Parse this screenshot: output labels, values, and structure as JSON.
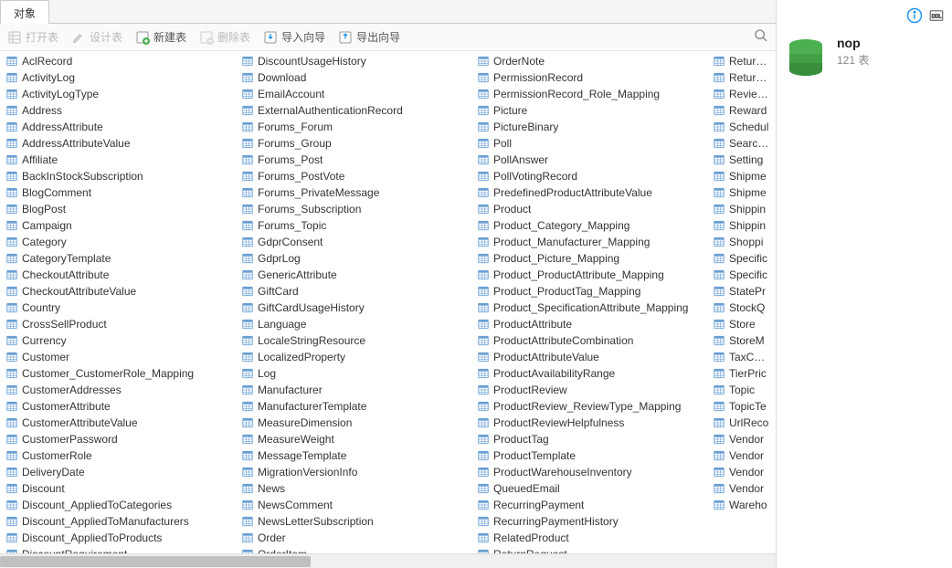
{
  "tab": {
    "label": "对象"
  },
  "toolbar": {
    "open": "打开表",
    "design": "设计表",
    "new": "新建表",
    "delete": "删除表",
    "import": "导入向导",
    "export": "导出向导"
  },
  "side": {
    "db_name": "nop",
    "table_count": "121 表"
  },
  "columns": [
    [
      "AclRecord",
      "ActivityLog",
      "ActivityLogType",
      "Address",
      "AddressAttribute",
      "AddressAttributeValue",
      "Affiliate",
      "BackInStockSubscription",
      "BlogComment",
      "BlogPost",
      "Campaign",
      "Category",
      "CategoryTemplate",
      "CheckoutAttribute",
      "CheckoutAttributeValue",
      "Country",
      "CrossSellProduct",
      "Currency",
      "Customer",
      "Customer_CustomerRole_Mapping",
      "CustomerAddresses",
      "CustomerAttribute",
      "CustomerAttributeValue",
      "CustomerPassword",
      "CustomerRole",
      "DeliveryDate",
      "Discount",
      "Discount_AppliedToCategories",
      "Discount_AppliedToManufacturers",
      "Discount_AppliedToProducts",
      "DiscountRequirement"
    ],
    [
      "DiscountUsageHistory",
      "Download",
      "EmailAccount",
      "ExternalAuthenticationRecord",
      "Forums_Forum",
      "Forums_Group",
      "Forums_Post",
      "Forums_PostVote",
      "Forums_PrivateMessage",
      "Forums_Subscription",
      "Forums_Topic",
      "GdprConsent",
      "GdprLog",
      "GenericAttribute",
      "GiftCard",
      "GiftCardUsageHistory",
      "Language",
      "LocaleStringResource",
      "LocalizedProperty",
      "Log",
      "Manufacturer",
      "ManufacturerTemplate",
      "MeasureDimension",
      "MeasureWeight",
      "MessageTemplate",
      "MigrationVersionInfo",
      "News",
      "NewsComment",
      "NewsLetterSubscription",
      "Order",
      "OrderItem"
    ],
    [
      "OrderNote",
      "PermissionRecord",
      "PermissionRecord_Role_Mapping",
      "Picture",
      "PictureBinary",
      "Poll",
      "PollAnswer",
      "PollVotingRecord",
      "PredefinedProductAttributeValue",
      "Product",
      "Product_Category_Mapping",
      "Product_Manufacturer_Mapping",
      "Product_Picture_Mapping",
      "Product_ProductAttribute_Mapping",
      "Product_ProductTag_Mapping",
      "Product_SpecificationAttribute_Mapping",
      "ProductAttribute",
      "ProductAttributeCombination",
      "ProductAttributeValue",
      "ProductAvailabilityRange",
      "ProductReview",
      "ProductReview_ReviewType_Mapping",
      "ProductReviewHelpfulness",
      "ProductTag",
      "ProductTemplate",
      "ProductWarehouseInventory",
      "QueuedEmail",
      "RecurringPayment",
      "RecurringPaymentHistory",
      "RelatedProduct",
      "ReturnRequest"
    ],
    [
      "ReturnR",
      "ReturnR",
      "ReviewT",
      "Reward",
      "Schedul",
      "SearchT",
      "Setting",
      "Shipme",
      "Shipme",
      "Shippin",
      "Shippin",
      "Shoppi",
      "Specific",
      "Specific",
      "StatePr",
      "StockQ",
      "Store",
      "StoreM",
      "TaxCate",
      "TierPric",
      "Topic",
      "TopicTe",
      "UrlReco",
      "Vendor",
      "Vendor",
      "Vendor",
      "Vendor",
      "Wareho"
    ]
  ]
}
